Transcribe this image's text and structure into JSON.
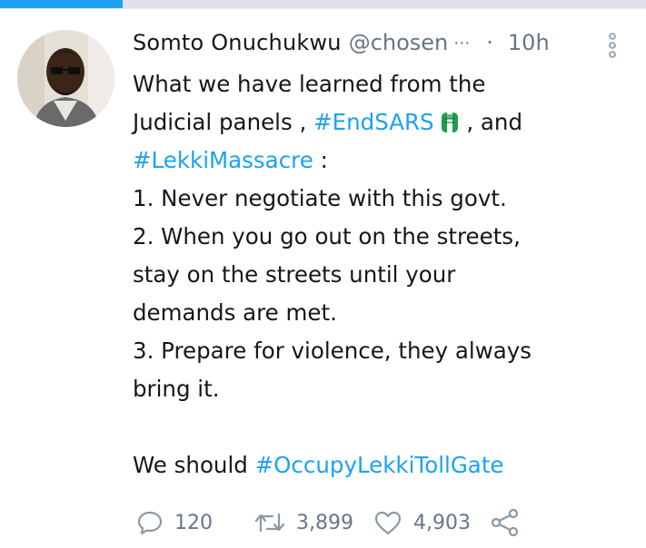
{
  "progress": {
    "fraction": 0.19,
    "color": "#1da1f2"
  },
  "tweet": {
    "author_name": "Somto Onuchukwu",
    "author_handle": "@chosen",
    "handle_truncation": "⋯",
    "separator": "·",
    "time": "10h",
    "body": {
      "line1": "What we have learned from the",
      "line2_text": "Judicial panels , ",
      "line2_tag": "#EndSARS",
      "line2_after": " , and",
      "line3_tag": "#LekkiMassacre",
      "line3_after": " :",
      "line4": "1. Never negotiate with this govt.",
      "line5": "2. When you go out on the streets,",
      "line6": "stay on the streets until your",
      "line7": "demands are met.",
      "line8": "3. Prepare for violence, they always",
      "line9": "bring it.",
      "line10_text": "We should ",
      "line10_tag": "#OccupyLekkiTollGate"
    },
    "actions": {
      "reply_count": "120",
      "retweet_count": "3,899",
      "like_count": "4,903"
    }
  },
  "icons": {
    "more": "vertical-dots-icon",
    "hashtag_emoji": "fist-flag-icon",
    "reply": "reply-icon",
    "retweet": "retweet-icon",
    "like": "heart-icon",
    "share": "share-icon"
  },
  "colors": {
    "link": "#1da1f2",
    "muted": "#657786",
    "text": "#14171a"
  }
}
